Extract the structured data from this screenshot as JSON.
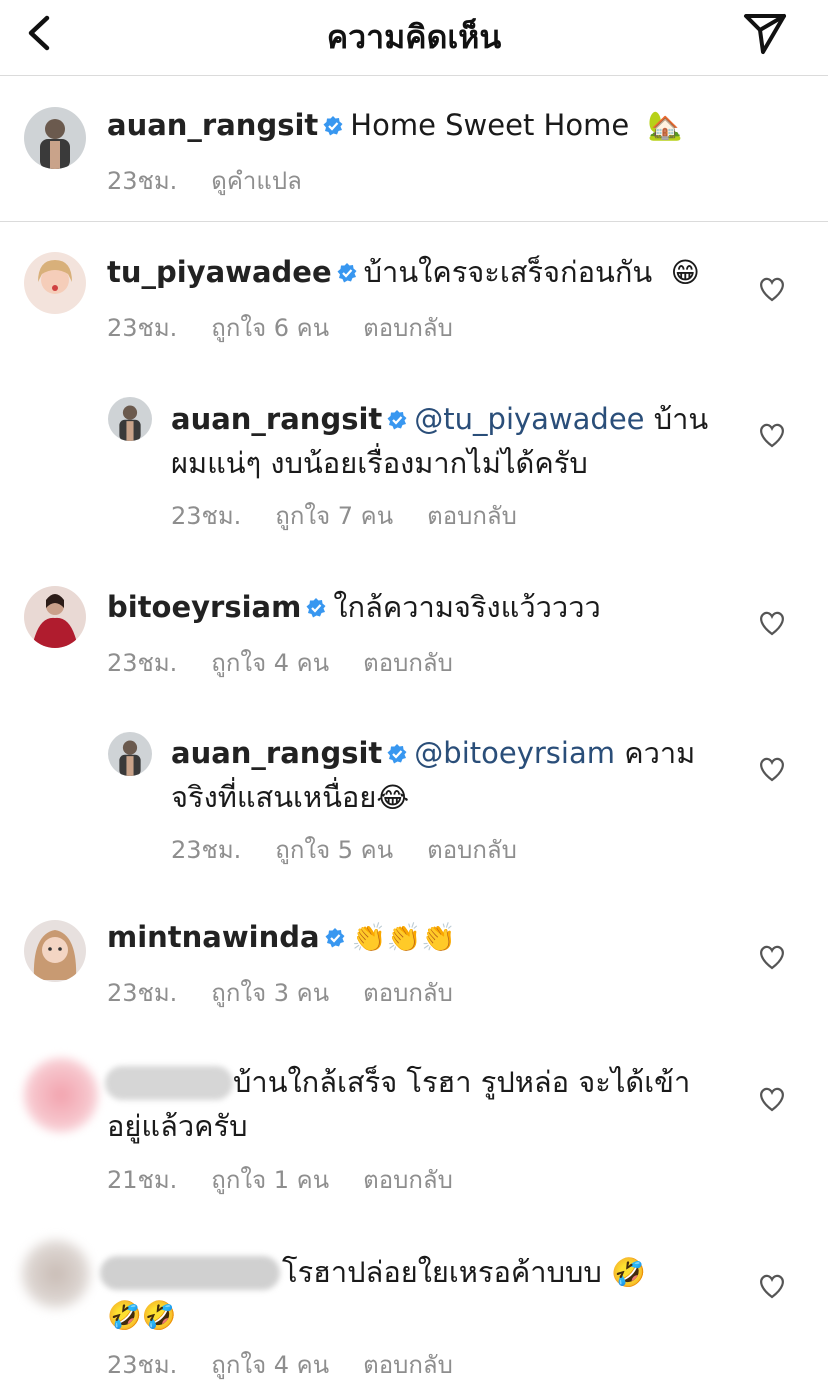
{
  "header": {
    "title": "ความคิดเห็น",
    "back_icon": "chevron-left-icon",
    "send_icon": "paper-plane-icon"
  },
  "caption": {
    "username": "auan_rangsit",
    "text": "Home Sweet Home",
    "emoji": "🏡",
    "time": "23ชม.",
    "translate_label": "ดูคำแปล"
  },
  "comments": [
    {
      "username": "tu_piyawadee",
      "text": "บ้านใครจะเสร็จก่อนกัน",
      "emoji": "😁",
      "time": "23ชม.",
      "likes": "ถูกใจ 6 คน",
      "reply": "ตอบกลับ"
    },
    {
      "username": "auan_rangsit",
      "mention": "@tu_piyawadee",
      "text1": "บ้าน",
      "text2": "ผมแน่ๆ งบน้อยเรื่องมากไม่ได้ครับ",
      "time": "23ชม.",
      "likes": "ถูกใจ 7 คน",
      "reply": "ตอบกลับ"
    },
    {
      "username": "bitoeyrsiam",
      "text": "ใกล้ความจริงแว้วววว",
      "time": "23ชม.",
      "likes": "ถูกใจ 4 คน",
      "reply": "ตอบกลับ"
    },
    {
      "username": "auan_rangsit",
      "mention": "@bitoeyrsiam",
      "text1": "ความ",
      "text2": "จริงที่แสนเหนื่อย",
      "emoji": "😂",
      "time": "23ชม.",
      "likes": "ถูกใจ 5 คน",
      "reply": "ตอบกลับ"
    },
    {
      "username": "mintnawinda",
      "emoji": "👏👏👏",
      "time": "23ชม.",
      "likes": "ถูกใจ 3 คน",
      "reply": "ตอบกลับ"
    },
    {
      "text1": "บ้านใกล้เสร็จ โรฮา รูปหล่อ  จะได้เข้า",
      "text2": "อยู่แล้วครับ",
      "time": "21ชม.",
      "likes": "ถูกใจ 1 คน",
      "reply": "ตอบกลับ"
    },
    {
      "text1": "โรฮาปล่อยใยเหรอค้าบบบ",
      "emoji1": "🤣",
      "emoji2": "🤣🤣",
      "time": "23ชม.",
      "likes": "ถูกใจ 4 คน",
      "reply": "ตอบกลับ"
    }
  ],
  "colors": {
    "mention": "#2a4e79",
    "verified": "#3897f0",
    "meta": "#8e8e8e",
    "divider": "#dbdbdb"
  },
  "icons": {
    "verified": "verified-badge-icon",
    "like": "heart-icon"
  }
}
